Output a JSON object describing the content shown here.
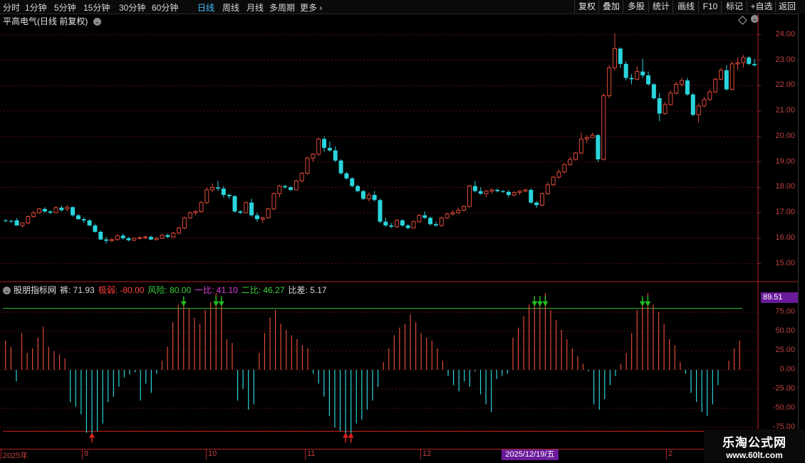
{
  "toolbar": {
    "periods": [
      "分时",
      "1分钟",
      "5分钟",
      "15分钟",
      "30分钟",
      "60分钟",
      "日线",
      "周线",
      "月线",
      "多周期",
      "更多"
    ],
    "active_period": "日线",
    "right_buttons": [
      "复权",
      "叠加",
      "多股",
      "统计",
      "画线",
      "F10",
      "标记",
      "+自选",
      "返回"
    ]
  },
  "chart": {
    "title": "平高电气(日线 前复权)",
    "price_ticks": [
      "24.00",
      "23.00",
      "22.00",
      "21.00",
      "20.00",
      "19.00",
      "18.00",
      "17.00",
      "16.00",
      "15.00"
    ]
  },
  "indicator": {
    "name": "股朋指标网",
    "values": [
      {
        "label": "裤: 71.93",
        "color": "#d8d8d8"
      },
      {
        "label": "极弱: -80.00",
        "color": "#ff4040"
      },
      {
        "label": "风险: 80.00",
        "color": "#40d040"
      },
      {
        "label": "一比: 41.10",
        "color": "#e040e0"
      },
      {
        "label": "二比: 46.27",
        "color": "#40d040"
      },
      {
        "label": "比差: 5.17",
        "color": "#d8d8d8"
      }
    ],
    "value_box": "89.51",
    "ticks": [
      "75.00",
      "50.00",
      "25.00",
      "0.00",
      "-25.00",
      "-50.00",
      "-75.00"
    ]
  },
  "dates": {
    "labels": [
      "2025年",
      "9",
      "10",
      "11",
      "12",
      "2"
    ],
    "selected": "2025/12/19/五"
  },
  "watermark": {
    "line1": "乐淘公式网",
    "line2": "www.60lt.com"
  },
  "colors": {
    "up": "#e04a3a",
    "down": "#2ad4dc",
    "green_line": "#33c033",
    "red_line": "#d02020"
  },
  "chart_data": {
    "type": "candlestick",
    "series": [
      {
        "name": "K线",
        "values": [
          [
            16.7,
            16.75,
            16.62,
            16.68
          ],
          [
            16.68,
            16.72,
            16.6,
            16.65
          ],
          [
            16.7,
            16.78,
            16.6,
            16.5
          ],
          [
            16.5,
            16.55,
            16.42,
            16.6
          ],
          [
            16.6,
            16.9,
            16.55,
            16.85
          ],
          [
            16.85,
            17.08,
            16.8,
            17.0
          ],
          [
            17.0,
            17.2,
            16.95,
            17.15
          ],
          [
            17.15,
            17.22,
            17.0,
            17.05
          ],
          [
            17.05,
            17.1,
            16.95,
            17.0
          ],
          [
            17.0,
            17.25,
            16.98,
            17.2
          ],
          [
            17.2,
            17.28,
            17.05,
            17.1
          ],
          [
            17.15,
            17.3,
            17.05,
            17.22
          ],
          [
            17.22,
            17.25,
            16.85,
            16.9
          ],
          [
            16.9,
            16.95,
            16.72,
            16.75
          ],
          [
            16.75,
            16.82,
            16.6,
            16.7
          ],
          [
            16.7,
            16.75,
            16.48,
            16.5
          ],
          [
            16.5,
            16.55,
            16.22,
            16.25
          ],
          [
            16.25,
            16.3,
            15.92,
            15.95
          ],
          [
            15.95,
            16.05,
            15.8,
            15.9
          ],
          [
            15.9,
            16.0,
            15.85,
            15.95
          ],
          [
            15.95,
            16.15,
            15.9,
            16.1
          ],
          [
            16.1,
            16.18,
            15.95,
            16.0
          ],
          [
            16.0,
            16.05,
            15.88,
            15.92
          ],
          [
            15.92,
            16.02,
            15.88,
            16.0
          ],
          [
            16.0,
            16.08,
            15.95,
            16.02
          ],
          [
            16.02,
            16.1,
            15.96,
            16.05
          ],
          [
            16.05,
            16.1,
            15.92,
            15.95
          ],
          [
            15.95,
            16.05,
            15.9,
            16.0
          ],
          [
            16.0,
            16.15,
            15.98,
            16.12
          ],
          [
            16.12,
            16.18,
            16.0,
            16.05
          ],
          [
            16.05,
            16.25,
            16.02,
            16.2
          ],
          [
            16.2,
            16.45,
            16.15,
            16.4
          ],
          [
            16.4,
            16.85,
            16.35,
            16.8
          ],
          [
            16.8,
            17.05,
            16.75,
            17.0
          ],
          [
            17.0,
            17.1,
            16.9,
            17.05
          ],
          [
            17.05,
            17.45,
            17.0,
            17.4
          ],
          [
            17.4,
            18.0,
            17.35,
            17.9
          ],
          [
            17.9,
            18.15,
            17.8,
            18.0
          ],
          [
            18.0,
            18.25,
            17.85,
            17.95
          ],
          [
            17.95,
            18.05,
            17.6,
            17.7
          ],
          [
            17.7,
            17.75,
            17.55,
            17.65
          ],
          [
            17.65,
            17.7,
            17.0,
            17.05
          ],
          [
            17.05,
            17.1,
            16.95,
            17.0
          ],
          [
            17.0,
            17.45,
            16.98,
            17.4
          ],
          [
            17.4,
            17.55,
            16.85,
            16.9
          ],
          [
            16.9,
            17.0,
            16.65,
            16.75
          ],
          [
            16.75,
            16.85,
            16.6,
            16.8
          ],
          [
            16.8,
            17.2,
            16.78,
            17.15
          ],
          [
            17.15,
            17.8,
            17.1,
            17.75
          ],
          [
            17.75,
            18.1,
            17.6,
            18.05
          ],
          [
            18.05,
            18.1,
            17.95,
            18.0
          ],
          [
            18.0,
            18.05,
            17.85,
            17.9
          ],
          [
            17.9,
            18.3,
            17.88,
            18.25
          ],
          [
            18.25,
            18.6,
            18.2,
            18.55
          ],
          [
            18.55,
            19.2,
            18.5,
            19.15
          ],
          [
            19.15,
            19.35,
            19.0,
            19.3
          ],
          [
            19.3,
            19.95,
            19.25,
            19.9
          ],
          [
            19.9,
            20.0,
            19.4,
            19.55
          ],
          [
            19.55,
            19.8,
            19.4,
            19.45
          ],
          [
            19.45,
            19.6,
            19.0,
            19.05
          ],
          [
            19.05,
            19.1,
            18.5,
            18.55
          ],
          [
            18.55,
            18.6,
            18.3,
            18.35
          ],
          [
            18.35,
            18.4,
            18.0,
            18.05
          ],
          [
            18.05,
            18.1,
            17.8,
            17.85
          ],
          [
            17.85,
            17.9,
            17.5,
            17.55
          ],
          [
            17.55,
            17.8,
            17.45,
            17.7
          ],
          [
            17.7,
            17.85,
            17.45,
            17.5
          ],
          [
            17.5,
            17.55,
            16.6,
            16.65
          ],
          [
            16.65,
            16.8,
            16.45,
            16.5
          ],
          [
            16.5,
            16.6,
            16.4,
            16.45
          ],
          [
            16.45,
            16.75,
            16.4,
            16.7
          ],
          [
            16.7,
            16.75,
            16.45,
            16.5
          ],
          [
            16.5,
            16.55,
            16.35,
            16.4
          ],
          [
            16.4,
            16.7,
            16.38,
            16.65
          ],
          [
            16.65,
            16.95,
            16.6,
            16.9
          ],
          [
            16.9,
            17.05,
            16.75,
            16.8
          ],
          [
            16.8,
            16.85,
            16.5,
            16.55
          ],
          [
            16.55,
            16.65,
            16.45,
            16.5
          ],
          [
            16.5,
            16.85,
            16.45,
            16.8
          ],
          [
            16.8,
            17.0,
            16.75,
            16.95
          ],
          [
            16.95,
            17.1,
            16.9,
            17.0
          ],
          [
            17.0,
            17.2,
            16.95,
            17.1
          ],
          [
            17.1,
            17.3,
            17.05,
            17.25
          ],
          [
            17.25,
            18.1,
            17.2,
            18.05
          ],
          [
            18.05,
            18.25,
            17.8,
            17.85
          ],
          [
            17.85,
            18.0,
            17.7,
            17.75
          ],
          [
            17.75,
            17.9,
            17.6,
            17.85
          ],
          [
            17.85,
            17.95,
            17.75,
            17.9
          ],
          [
            17.9,
            17.95,
            17.8,
            17.85
          ],
          [
            17.85,
            17.9,
            17.78,
            17.82
          ],
          [
            17.82,
            17.9,
            17.6,
            17.7
          ],
          [
            17.7,
            17.85,
            17.65,
            17.8
          ],
          [
            17.8,
            17.9,
            17.7,
            17.85
          ],
          [
            17.85,
            17.95,
            17.8,
            17.9
          ],
          [
            17.9,
            17.95,
            17.35,
            17.4
          ],
          [
            17.4,
            17.45,
            17.2,
            17.3
          ],
          [
            17.3,
            17.8,
            17.25,
            17.75
          ],
          [
            17.75,
            18.2,
            17.7,
            18.1
          ],
          [
            18.1,
            18.45,
            18.05,
            18.4
          ],
          [
            18.4,
            18.7,
            18.35,
            18.6
          ],
          [
            18.6,
            18.95,
            18.55,
            18.9
          ],
          [
            18.9,
            19.2,
            18.85,
            19.1
          ],
          [
            19.1,
            19.4,
            19.05,
            19.35
          ],
          [
            19.35,
            20.15,
            19.3,
            19.9
          ],
          [
            19.9,
            20.05,
            19.75,
            19.95
          ],
          [
            19.95,
            20.15,
            20.0,
            20.05
          ],
          [
            20.05,
            20.1,
            19.0,
            19.1
          ],
          [
            19.1,
            21.7,
            19.05,
            21.6
          ],
          [
            21.6,
            22.8,
            21.5,
            22.7
          ],
          [
            22.7,
            24.05,
            22.6,
            23.45
          ],
          [
            23.45,
            23.5,
            22.7,
            22.85
          ],
          [
            22.85,
            22.95,
            22.2,
            22.3
          ],
          [
            22.3,
            22.45,
            22.05,
            22.25
          ],
          [
            22.25,
            22.75,
            22.2,
            22.55
          ],
          [
            22.55,
            23.05,
            22.3,
            22.4
          ],
          [
            22.4,
            22.55,
            22.0,
            22.05
          ],
          [
            22.05,
            22.1,
            21.45,
            21.5
          ],
          [
            21.5,
            21.7,
            20.6,
            20.9
          ],
          [
            20.9,
            21.35,
            20.85,
            21.25
          ],
          [
            21.25,
            21.8,
            21.2,
            21.7
          ],
          [
            21.7,
            22.15,
            21.65,
            22.05
          ],
          [
            22.05,
            22.3,
            21.95,
            22.2
          ],
          [
            22.2,
            22.3,
            21.6,
            21.65
          ],
          [
            21.65,
            21.7,
            20.8,
            20.85
          ],
          [
            20.85,
            21.3,
            20.55,
            21.2
          ],
          [
            21.2,
            21.55,
            21.15,
            21.45
          ],
          [
            21.45,
            21.85,
            21.4,
            21.75
          ],
          [
            21.75,
            22.3,
            21.7,
            22.25
          ],
          [
            22.25,
            22.7,
            22.2,
            22.6
          ],
          [
            22.6,
            22.8,
            21.8,
            21.85
          ],
          [
            21.85,
            22.95,
            21.8,
            22.85
          ],
          [
            22.85,
            23.1,
            22.6,
            22.9
          ],
          [
            22.9,
            23.2,
            22.7,
            23.1
          ],
          [
            23.1,
            23.15,
            22.8,
            22.85
          ],
          [
            22.85,
            23.05,
            22.75,
            22.8
          ]
        ]
      },
      {
        "name": "股朋指标网",
        "values": [
          38,
          30,
          -15,
          48,
          22,
          28,
          42,
          56,
          30,
          24,
          20,
          15,
          -42,
          -48,
          -58,
          -82,
          -86,
          -80,
          -70,
          -42,
          -35,
          -22,
          -10,
          -6,
          -3,
          -40,
          -18,
          -30,
          -5,
          12,
          30,
          62,
          85,
          95,
          80,
          68,
          60,
          78,
          88,
          100,
          92,
          40,
          35,
          -40,
          -25,
          -52,
          -45,
          22,
          48,
          68,
          78,
          60,
          52,
          45,
          40,
          32,
          28,
          -5,
          -18,
          -35,
          -60,
          -75,
          -80,
          -88,
          -92,
          -70,
          -65,
          -52,
          -40,
          -22,
          10,
          28,
          45,
          55,
          60,
          72,
          62,
          48,
          42,
          38,
          28,
          12,
          -8,
          -20,
          -28,
          -15,
          -22,
          -2,
          -32,
          -45,
          -55,
          -12,
          -8,
          -5,
          42,
          55,
          70,
          85,
          92,
          96,
          100,
          78,
          65,
          52,
          40,
          28,
          18,
          8,
          -2,
          -45,
          -52,
          -38,
          -20,
          -8,
          8,
          22,
          48,
          78,
          92,
          100,
          85,
          75,
          60,
          40,
          32,
          10,
          -5,
          -30,
          -42,
          -55,
          -60,
          -45,
          -20,
          0,
          12,
          28,
          38
        ]
      }
    ],
    "ylim_price": [
      14.6,
      24.3
    ],
    "ylim_indicator": [
      -100,
      100
    ],
    "thresholds": {
      "风险": 80,
      "极弱": -80
    },
    "grid": true
  }
}
